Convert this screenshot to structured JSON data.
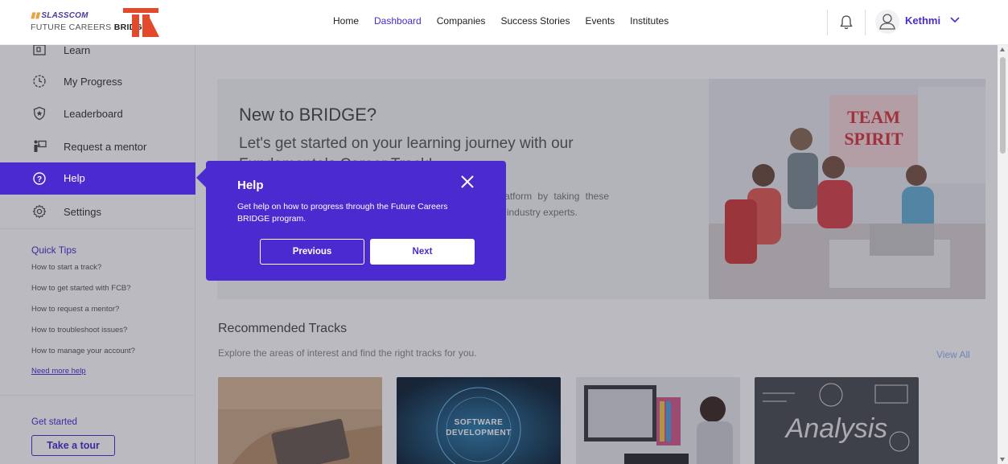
{
  "logo": {
    "line1": "SLASSCOM",
    "line2_prefix": "FUTURE CAREERS ",
    "line2_bold": "BRIDGE"
  },
  "nav": [
    {
      "label": "Home",
      "active": false
    },
    {
      "label": "Dashboard",
      "active": true
    },
    {
      "label": "Companies",
      "active": false
    },
    {
      "label": "Success Stories",
      "active": false
    },
    {
      "label": "Events",
      "active": false
    },
    {
      "label": "Institutes",
      "active": false
    }
  ],
  "user": {
    "name": "Kethmi"
  },
  "sidebar": {
    "items": [
      {
        "label": "Learn",
        "icon": "learn-icon"
      },
      {
        "label": "My Progress",
        "icon": "clock-icon"
      },
      {
        "label": "Leaderboard",
        "icon": "shield-star-icon"
      },
      {
        "label": "Request a mentor",
        "icon": "mentor-icon"
      },
      {
        "label": "Help",
        "icon": "help-icon"
      },
      {
        "label": "Settings",
        "icon": "gear-icon"
      }
    ],
    "quick_tips": {
      "heading": "Quick Tips",
      "items": [
        "How to start a track?",
        "How to get started with FCB?",
        "How to request a mentor?",
        "How to troubleshoot issues?",
        "How to manage your account?"
      ],
      "more": "Need more help"
    },
    "get_started": "Get started",
    "tour_button": "Take a tour"
  },
  "hero": {
    "title": "New to BRIDGE?",
    "subtitle": "Let's get started on your learning journey with our Fundamentals Career Track!",
    "description": "Explore and get to know the Future Careers BRIDGE platform by taking these Fundamentals tracks and completing the mini challenges from industry experts."
  },
  "recommended": {
    "title": "Recommended Tracks",
    "subtitle": "Explore the areas of interest and find the right tracks for you.",
    "view_all": "View All",
    "cards": [
      {
        "text": ""
      },
      {
        "text": "SOFTWARE\nDEVELOPMENT"
      },
      {
        "text": ""
      },
      {
        "text": "Analysis"
      }
    ]
  },
  "popover": {
    "title": "Help",
    "body": "Get help on how to progress through the Future Careers BRIDGE program.",
    "previous": "Previous",
    "next": "Next"
  },
  "colors": {
    "accent": "#4b2bd0",
    "link": "#8fb3ef"
  }
}
